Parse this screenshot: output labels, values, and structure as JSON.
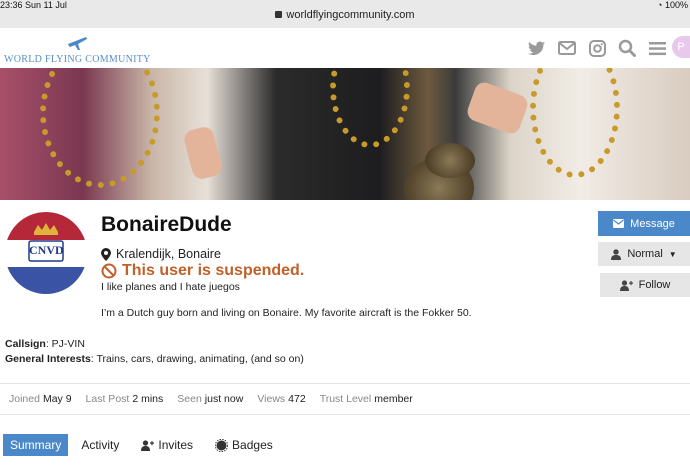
{
  "status_bar": {
    "time_date": "23:36   Sun 11 Jul",
    "url": "worldflyingcommunity.com",
    "battery": "100%"
  },
  "header": {
    "logo_text": "WORLD FLYING COMMUNITY",
    "icons": [
      "twitter-icon",
      "mail-icon",
      "instagram-icon",
      "search-icon",
      "hamburger-menu-icon",
      "user-avatar"
    ],
    "avatar_letter": "P"
  },
  "profile": {
    "username": "BonaireDude",
    "location": "Kralendijk, Bonaire",
    "suspended_text": "This user is suspended.",
    "bio_short": "I like planes and I hate juegos",
    "bio_long": "I’m a Dutch guy born and living on Bonaire. My favorite aircraft is the Fokker 50.",
    "avatar_monogram": "CNVD"
  },
  "actions": {
    "message_label": "Message",
    "notification_label": "Normal",
    "follow_label": "Follow"
  },
  "custom_fields": [
    {
      "label": "Callsign",
      "value": ": PJ-VIN"
    },
    {
      "label": "General Interests",
      "value": ": Trains, cars, drawing, animating, (and so on)"
    }
  ],
  "stats": [
    {
      "label": "Joined",
      "value": "May 9"
    },
    {
      "label": "Last Post",
      "value": "2 mins"
    },
    {
      "label": "Seen",
      "value": "just now"
    },
    {
      "label": "Views",
      "value": "472"
    },
    {
      "label": "Trust Level",
      "value": "member"
    }
  ],
  "tabs": [
    {
      "label": "Summary",
      "active": true
    },
    {
      "label": "Activity"
    },
    {
      "label": "Invites"
    },
    {
      "label": "Badges"
    }
  ],
  "colors": {
    "accent": "#4a88c9",
    "suspended": "#c0602a",
    "logo": "#5a8dc4"
  }
}
